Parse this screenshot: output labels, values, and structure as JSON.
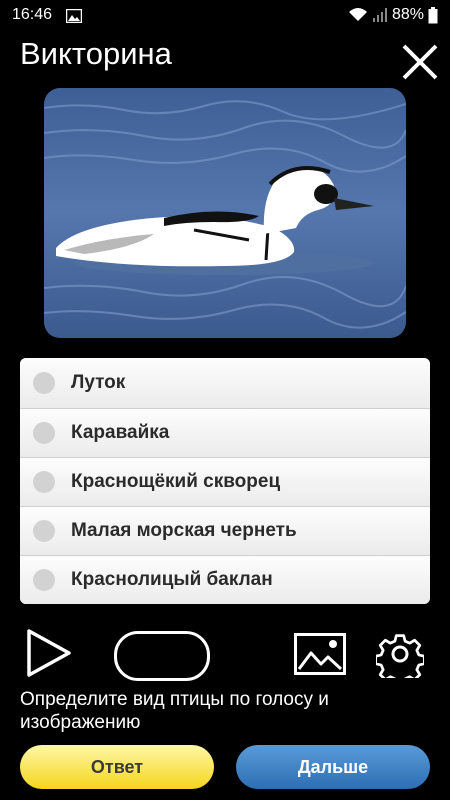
{
  "status_bar": {
    "time": "16:46",
    "battery": "88%",
    "icons": [
      "gallery-icon",
      "wifi-icon",
      "signal-icon",
      "battery-icon"
    ]
  },
  "header": {
    "title": "Викторина",
    "close_icon": "close-icon"
  },
  "photo": {
    "subject": "bird-photo"
  },
  "answers": [
    {
      "label": "Луток"
    },
    {
      "label": "Каравайка"
    },
    {
      "label": "Краснощёкий скворец"
    },
    {
      "label": "Малая морская чернеть"
    },
    {
      "label": "Краснолицый баклан"
    }
  ],
  "controls": {
    "play_icon": "play-icon",
    "image_icon": "image-icon",
    "settings_icon": "gear-icon"
  },
  "hint": "Определите вид птицы по голосу и изображению",
  "buttons": {
    "answer_label": "Ответ",
    "next_label": "Дальше"
  },
  "colors": {
    "background": "#000000",
    "answer_button": "#f5d61c",
    "next_button": "#2d6fb4"
  }
}
